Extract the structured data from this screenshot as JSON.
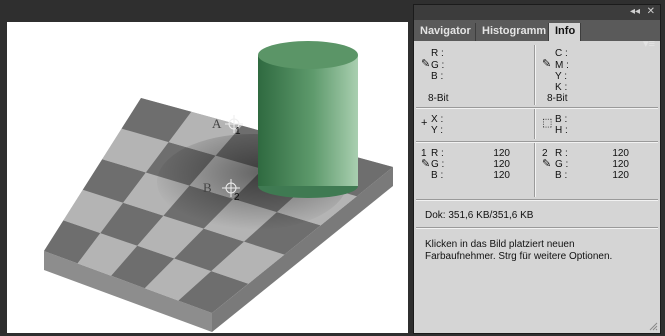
{
  "canvas": {
    "label_a": "A",
    "label_b": "B",
    "sampler1_number": "1",
    "sampler2_number": "2"
  },
  "panel": {
    "collapse_glyph": "◂◂",
    "close_glyph": "✕",
    "menu_glyph": "▾≡",
    "tabs": [
      {
        "label": "Navigator",
        "active": false
      },
      {
        "label": "Histogramm",
        "active": false
      },
      {
        "label": "Info",
        "active": true
      }
    ],
    "rgb_block": {
      "r": "R :",
      "g": "G :",
      "b": "B :",
      "bitdepth": "8-Bit"
    },
    "cmyk_block": {
      "c": "C :",
      "m": "M :",
      "y": "Y :",
      "k": "K :",
      "bitdepth": "8-Bit"
    },
    "position": {
      "x": "X :",
      "y": "Y :"
    },
    "size": {
      "w": "B :",
      "h": "H :"
    },
    "sampler1": {
      "number": "1",
      "r": "R :",
      "g": "G :",
      "b": "B :",
      "r_val": "120",
      "g_val": "120",
      "b_val": "120"
    },
    "sampler2": {
      "number": "2",
      "r": "R :",
      "g": "G :",
      "b": "B :",
      "r_val": "120",
      "g_val": "120",
      "b_val": "120"
    },
    "doc_size": "Dok: 351,6 KB/351,6 KB",
    "hint_line1": "Klicken in das Bild platziert neuen",
    "hint_line2": "Farbaufnehmer. Strg für weitere Optionen."
  },
  "icons": {
    "eyedropper": "eyedropper-icon",
    "crosshair": "crosshair-icon",
    "selection": "selection-icon",
    "resize": "resize-grip-icon"
  },
  "colors": {
    "panel_bg": "#d5d5d5",
    "tab_bar": "#5a5a5a",
    "cylinder": "#4f8a60",
    "light_square": "#b4b4b4",
    "dark_square": "#6e6e6e"
  }
}
